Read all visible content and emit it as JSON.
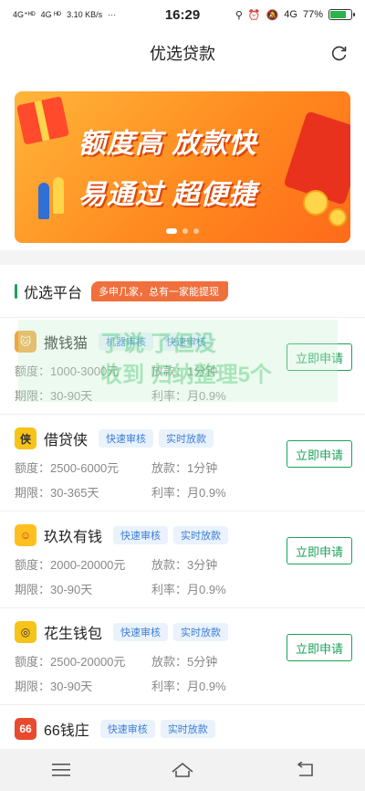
{
  "status": {
    "network1": "4G⁺ᴴᴰ",
    "network2": "4G ᴴᴰ",
    "speed": "3.10 KB/s",
    "dots": "···",
    "time": "16:29",
    "network3": "4G",
    "battery": "77%",
    "battery_fraction": 0.77
  },
  "header": {
    "title": "优选贷款"
  },
  "banner": {
    "line1": "额度高 放款快",
    "line2": "易通过 超便捷"
  },
  "section": {
    "title": "优选平台",
    "tag": "多申几家，总有一家能提现"
  },
  "items": [
    {
      "name": "撒钱猫",
      "badges": [
        "机器审核",
        "快速审核"
      ],
      "quota": "额度：1000-3000元",
      "loan": "放款：1分钟",
      "term": "期限：30-90天",
      "rate": "利率：月0.9%",
      "apply": "立即申请"
    },
    {
      "name": "借贷侠",
      "badges": [
        "快速审核",
        "实时放款"
      ],
      "quota": "额度：2500-6000元",
      "loan": "放款：1分钟",
      "term": "期限：30-365天",
      "rate": "利率：月0.9%",
      "apply": "立即申请"
    },
    {
      "name": "玖玖有钱",
      "badges": [
        "快速审核",
        "实时放款"
      ],
      "quota": "额度：2000-20000元",
      "loan": "放款：3分钟",
      "term": "期限：30-90天",
      "rate": "利率：月0.9%",
      "apply": "立即申请"
    },
    {
      "name": "花生钱包",
      "badges": [
        "快速审核",
        "实时放款"
      ],
      "quota": "额度：2500-20000元",
      "loan": "放款：5分钟",
      "term": "期限：30-90天",
      "rate": "利率：月0.9%",
      "apply": "立即申请"
    },
    {
      "name": "66钱庄",
      "badges": [
        "快速审核",
        "实时放款"
      ],
      "quota": "",
      "loan": "",
      "term": "",
      "rate": "",
      "apply": ""
    }
  ],
  "watermark": {
    "line1": "了说 了但没",
    "line2": "收到 归纳整理5个"
  },
  "icons": {
    "refresh": "refresh-icon",
    "menu": "menu-icon",
    "home": "home-icon",
    "back": "back-icon"
  },
  "colors": {
    "accent": "#1aa35a",
    "tag": "#ef6f3d",
    "badge_text": "#3d7fd6"
  }
}
